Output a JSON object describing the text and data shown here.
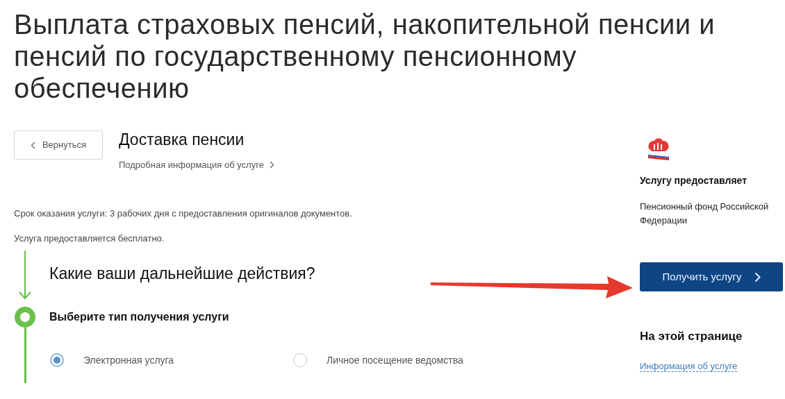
{
  "title": "Выплата страховых пенсий, накопительной пенсии и пенсий по государственному пенсионному обеспечению",
  "back_button": {
    "label": "Вернуться"
  },
  "service": {
    "name": "Доставка пенсии",
    "details_link": "Подробная информация об услуге"
  },
  "info": [
    "Срок оказания услуги: 3 рабочих дня с предоставления оригиналов документов.",
    "Услуга предоставляется бесплатно."
  ],
  "next_steps": {
    "heading": "Какие ваши дальнейшие действия?",
    "step_title": "Выберите тип получения услуги",
    "options": [
      {
        "label": "Электронная услуга",
        "selected": true
      },
      {
        "label": "Личное посещение ведомства",
        "selected": false
      }
    ]
  },
  "provider": {
    "heading": "Услугу предоставляет",
    "name": "Пенсионный фонд Российской Федерации"
  },
  "get_service_button": {
    "label": "Получить услугу"
  },
  "on_this_page": {
    "heading": "На этой странице",
    "links": [
      "Информация об услуге"
    ]
  }
}
